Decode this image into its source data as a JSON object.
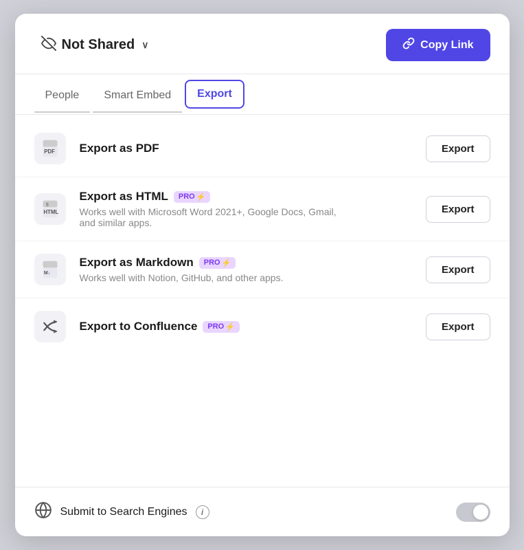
{
  "header": {
    "not_shared_label": "Not Shared",
    "copy_link_label": "Copy Link",
    "chevron": "∨"
  },
  "tabs": [
    {
      "id": "people",
      "label": "People",
      "active": false
    },
    {
      "id": "smart-embed",
      "label": "Smart Embed",
      "active": false
    },
    {
      "id": "export",
      "label": "Export",
      "active": true
    }
  ],
  "export_items": [
    {
      "id": "pdf",
      "title": "Export as PDF",
      "desc": "",
      "pro": false,
      "button_label": "Export"
    },
    {
      "id": "html",
      "title": "Export as HTML",
      "desc": "Works well with Microsoft Word 2021+, Google Docs, Gmail, and similar apps.",
      "pro": true,
      "button_label": "Export"
    },
    {
      "id": "markdown",
      "title": "Export as Markdown",
      "desc": "Works well with Notion, GitHub, and other apps.",
      "pro": true,
      "button_label": "Export"
    },
    {
      "id": "confluence",
      "title": "Export to Confluence",
      "desc": "",
      "pro": true,
      "button_label": "Export"
    }
  ],
  "footer": {
    "label": "Submit to Search Engines",
    "toggle_state": false
  },
  "icons": {
    "eye_slash": "eye-slash-icon",
    "link": "link-icon",
    "globe": "globe-icon",
    "info": "i",
    "pdf": "pdf-icon",
    "html5": "html5-icon",
    "markdown": "markdown-icon",
    "confluence": "confluence-icon",
    "pro_bolt": "⚡"
  }
}
